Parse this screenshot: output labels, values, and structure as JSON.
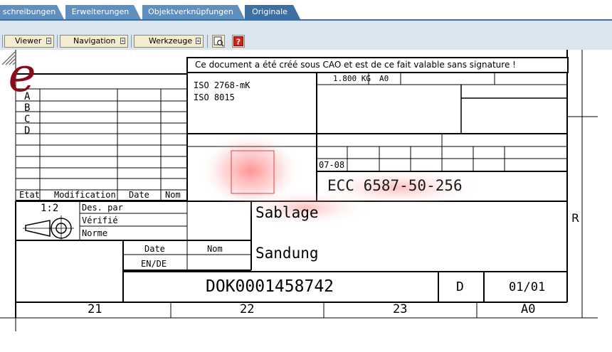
{
  "tabs": [
    {
      "label": "schreibungen"
    },
    {
      "label": "Erweiterungen"
    },
    {
      "label": "Objektverknüpfungen"
    },
    {
      "label": "Originale"
    }
  ],
  "toolbar": {
    "viewer": "Viewer",
    "navigation": "Navigation",
    "werkzeuge": "Werkzeuge"
  },
  "colors": {
    "tab": "#5f8fbe",
    "tab_active": "#3d6fa3",
    "toolbar_bg": "#dbe5ef",
    "button_bg": "#f3ecd1",
    "logo_red": "#8b0c18"
  },
  "drawing": {
    "notice": "Ce document a été créé sous CAO et est de ce fait valable sans signature !",
    "standards": [
      "ISO 2768-mK",
      "ISO 8015"
    ],
    "mass": "1.800 KG",
    "format_top": "A0",
    "date_code": "07-08",
    "ecc_number": "ECC 6587-50-256",
    "revision_letters": [
      "A",
      "B",
      "C",
      "D"
    ],
    "rev_headers": {
      "etat": "Etat",
      "modification": "Modification",
      "date": "Date",
      "nom": "Nom"
    },
    "scale": "1:2",
    "approvals": {
      "des_par": "Des. par",
      "verifie": "Vérifié",
      "norme": "Norme"
    },
    "sign_headers": {
      "date": "Date",
      "nom": "Nom"
    },
    "standard_code": "EN/DE",
    "title_fr": "Sablage",
    "title_de": "Sandung",
    "document_number": "DOK0001458742",
    "revision": "D",
    "sheet": "01/01",
    "side_letter": "R",
    "zones": [
      "21",
      "22",
      "23"
    ],
    "format_bottom": "A0"
  }
}
